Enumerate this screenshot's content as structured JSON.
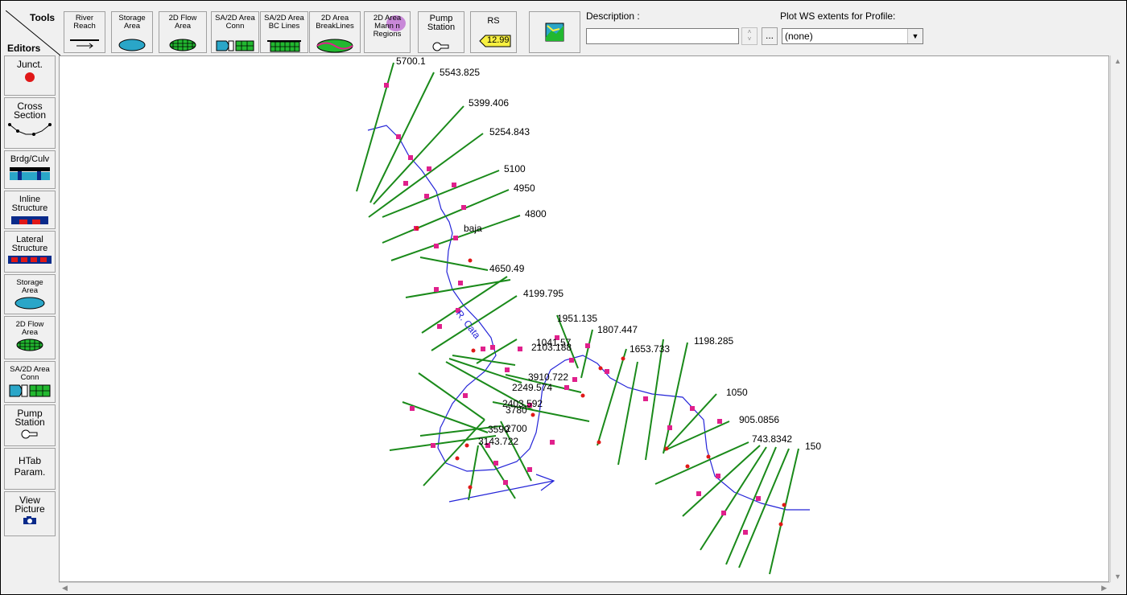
{
  "toolbar": {
    "tools_label": "Tools",
    "editors_label": "Editors",
    "buttons": [
      {
        "label": "River\nReach"
      },
      {
        "label": "Storage\nArea"
      },
      {
        "label": "2D Flow\nArea"
      },
      {
        "label": "SA/2D Area\nConn"
      },
      {
        "label": "SA/2D Area\nBC Lines"
      },
      {
        "label": "2D Area\nBreakLines"
      },
      {
        "label": "2D Area\nMann n\nRegions"
      },
      {
        "label": "Pump\nStation"
      },
      {
        "label": "RS"
      }
    ],
    "rs_value": "12.99",
    "description_label": "Description :",
    "description_value": "",
    "dots_label": "...",
    "plot_ws_label": "Plot WS extents for Profile:",
    "plot_ws_value": "(none)"
  },
  "sidebar": {
    "buttons": [
      {
        "label": "Junct."
      },
      {
        "label": "Cross\nSection"
      },
      {
        "label": "Brdg/Culv"
      },
      {
        "label": "Inline\nStructure"
      },
      {
        "label": "Lateral\nStructure"
      },
      {
        "label": "Storage\nArea"
      },
      {
        "label": "2D Flow\nArea"
      },
      {
        "label": "SA/2D Area\nConn"
      },
      {
        "label": "Pump\nStation"
      },
      {
        "label": "HTab\nParam."
      },
      {
        "label": "View\nPicture"
      }
    ]
  },
  "map": {
    "river_label": "R. Cata",
    "reach_label": "baja",
    "cross_sections": [
      {
        "rs": "5700.1"
      },
      {
        "rs": "5543.825"
      },
      {
        "rs": "5399.406"
      },
      {
        "rs": "5254.843"
      },
      {
        "rs": "5100"
      },
      {
        "rs": "4950"
      },
      {
        "rs": "4800"
      },
      {
        "rs": "4650.49"
      },
      {
        "rs": "4199.795"
      },
      {
        "rs": "1951.135"
      },
      {
        "rs": "1807.447"
      },
      {
        "rs": "1041.57"
      },
      {
        "rs": "2103.188"
      },
      {
        "rs": "1653.733"
      },
      {
        "rs": "1198.285"
      },
      {
        "rs": "3910.722"
      },
      {
        "rs": "2249.574"
      },
      {
        "rs": "1050"
      },
      {
        "rs": "2403.592"
      },
      {
        "rs": "3780"
      },
      {
        "rs": "905.0856"
      },
      {
        "rs": "3590"
      },
      {
        "rs": "2700"
      },
      {
        "rs": "3143.722"
      },
      {
        "rs": "743.8342"
      },
      {
        "rs": "150"
      }
    ]
  },
  "colors": {
    "cross_section": "#1a8a1a",
    "river": "#2424d8",
    "bank_marker": "#e0208c",
    "bank_point": "#e01818"
  }
}
